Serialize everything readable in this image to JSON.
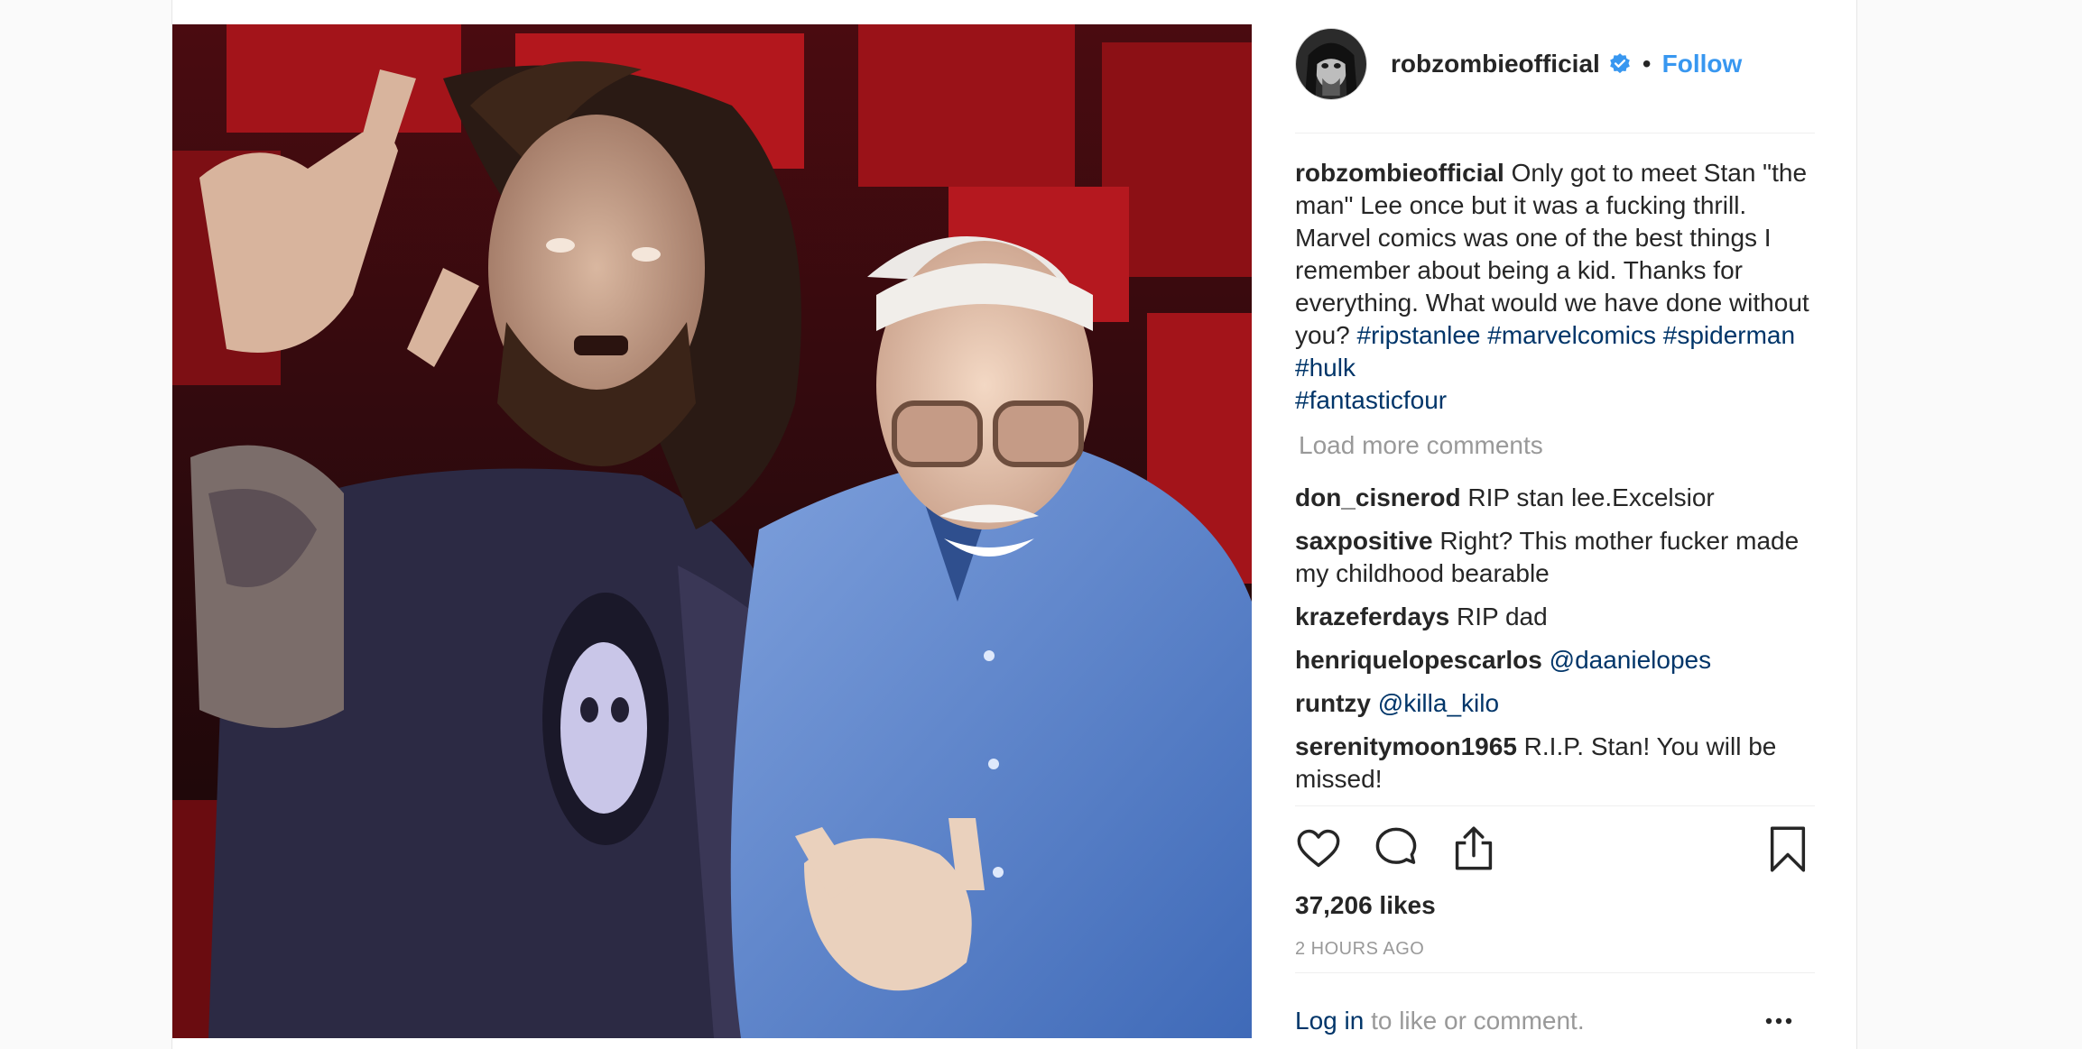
{
  "post": {
    "author": "robzombieofficial",
    "follow_label": "Follow",
    "separator": "•",
    "photo_description": "Two men posing with devil-horns hand gestures",
    "caption": {
      "username": "robzombieofficial",
      "text": "Only got to meet Stan \"the man\" Lee once but it was a fucking thrill. Marvel comics was one of the best things I remember about being a kid. Thanks for everything. What would we have done without you?",
      "hashtags": [
        "#ripstanlee",
        "#marvelcomics",
        "#spiderman",
        "#hulk",
        "#fantasticfour"
      ]
    },
    "load_more": "Load more comments",
    "comments": [
      {
        "user": "don_cisnerod",
        "text": "RIP stan lee.Excelsior",
        "mention": ""
      },
      {
        "user": "saxpositive",
        "text": "Right? This mother fucker made my childhood bearable",
        "mention": ""
      },
      {
        "user": "krazeferdays",
        "text": "RIP dad",
        "mention": ""
      },
      {
        "user": "henriquelopescarlos",
        "text": "",
        "mention": "@daanielopes"
      },
      {
        "user": "runtzy",
        "text": "",
        "mention": "@killa_kilo"
      },
      {
        "user": "serenitymoon1965",
        "text": "R.I.P. Stan! You will be missed!",
        "mention": ""
      }
    ],
    "likes": "37,206 likes",
    "time": "2 HOURS AGO",
    "login_link": "Log in",
    "login_suffix": " to like or comment.",
    "more_icon": "ellipsis-icon"
  },
  "colors": {
    "link_blue": "#3897f0",
    "hashtag_blue": "#003569",
    "muted": "#999999",
    "verified": "#3897f0"
  }
}
